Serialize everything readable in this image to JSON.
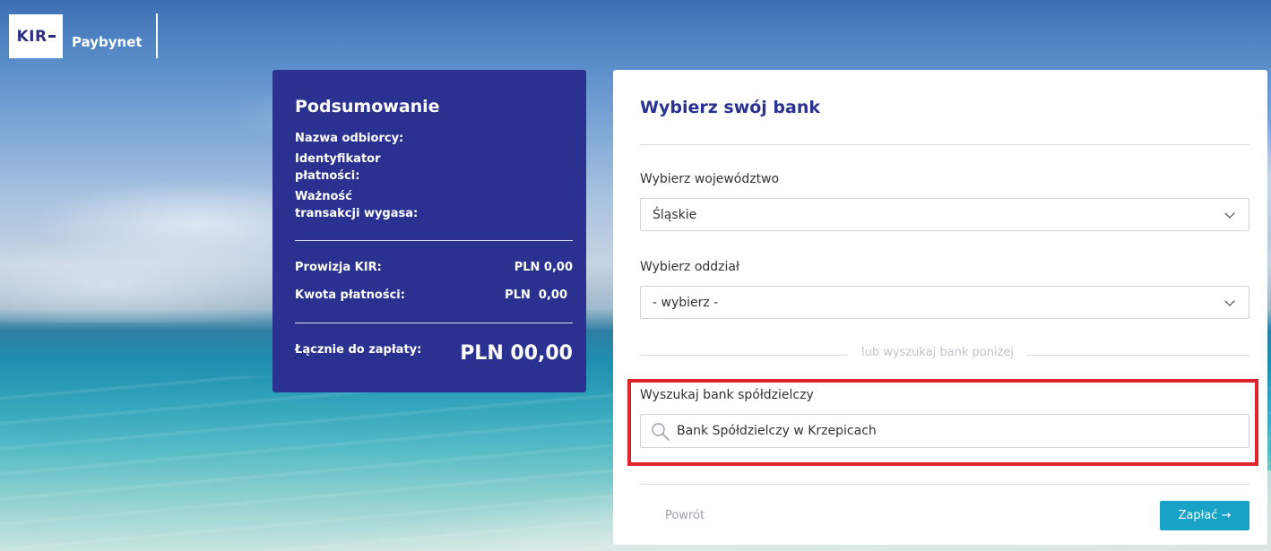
{
  "header": {
    "logo_kir": "KIR",
    "logo_brand": "Paybynet"
  },
  "summary": {
    "title": "Podsumowanie",
    "recipient_label": "Nazwa odbiorcy:",
    "payment_id_label": "Identyfikator płatności:",
    "expiry_label": "Ważność transakcji wygasa:",
    "fee_label": "Prowizja KIR:",
    "fee_value": "PLN 0,00",
    "amount_label": "Kwota płatności:",
    "amount_value": "PLN  0,00",
    "total_label": "Łącznie do zapłaty:",
    "total_value": "PLN 00,00"
  },
  "bank": {
    "title": "Wybierz swój bank",
    "voivodeship_label": "Wybierz województwo",
    "voivodeship_value": "Śląskie",
    "branch_label": "Wybierz oddział",
    "branch_value": "- wybierz -",
    "or_text": "lub wyszukaj bank poniżej",
    "search_label": "Wyszukaj bank spółdzielczy",
    "search_value": "Bank Spółdzielczy w Krzepicach",
    "back_label": "Powrót",
    "pay_label": "Zapłać →"
  },
  "colors": {
    "brand_navy": "#2b3190",
    "pay_button": "#17a2c6",
    "highlight_red": "#e1232e"
  },
  "icons": [
    "search-icon",
    "chevron-down-icon"
  ]
}
